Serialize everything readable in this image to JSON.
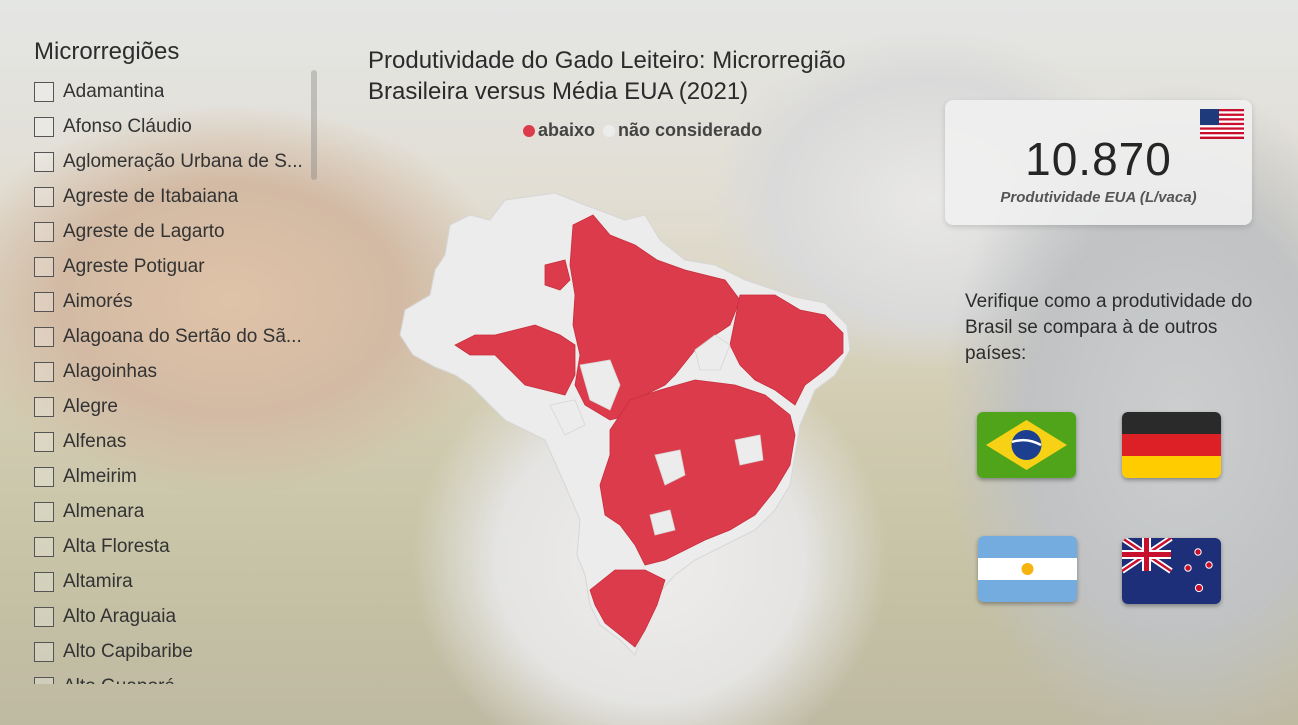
{
  "slicer": {
    "title": "Microrregiões",
    "items": [
      "Adamantina",
      "Afonso Cláudio",
      "Aglomeração Urbana de S...",
      "Agreste de Itabaiana",
      "Agreste de Lagarto",
      "Agreste Potiguar",
      "Aimorés",
      "Alagoana do Sertão do Sã...",
      "Alagoinhas",
      "Alegre",
      "Alfenas",
      "Almeirim",
      "Almenara",
      "Alta Floresta",
      "Altamira",
      "Alto Araguaia",
      "Alto Capibaribe",
      "Alto Guaporé"
    ]
  },
  "map": {
    "title": "Produtividade do Gado Leiteiro: Microrregião Brasileira versus Média EUA (2021)",
    "legend": [
      {
        "label": "abaixo",
        "color": "#dc3b4b"
      },
      {
        "label": "não considerado",
        "color": "#ececec"
      }
    ]
  },
  "kpi": {
    "value": "10.870",
    "label": "Produtividade EUA (L/vaca)",
    "flag": "usa-flag-icon"
  },
  "compare": {
    "text": "Verifique como a produtividade do Brasil se compara à de outros países:",
    "flags": [
      "brazil-flag",
      "germany-flag",
      "argentina-flag",
      "new-zealand-flag"
    ]
  },
  "colors": {
    "below": "#dc3b4b",
    "not_considered": "#ececec"
  }
}
